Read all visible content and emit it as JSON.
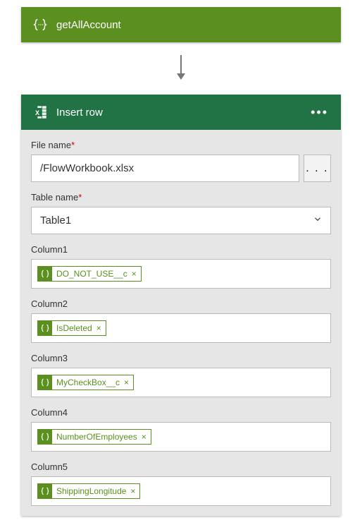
{
  "trigger": {
    "title": "getAllAccount"
  },
  "action": {
    "title": "Insert row",
    "fields": {
      "fileName": {
        "label": "File name",
        "value": "/FlowWorkbook.xlsx",
        "required": true
      },
      "tableName": {
        "label": "Table name",
        "value": "Table1",
        "required": true
      },
      "columns": [
        {
          "label": "Column1",
          "token": "DO_NOT_USE__c"
        },
        {
          "label": "Column2",
          "token": "IsDeleted"
        },
        {
          "label": "Column3",
          "token": "MyCheckBox__c"
        },
        {
          "label": "Column4",
          "token": "NumberOfEmployees"
        },
        {
          "label": "Column5",
          "token": "ShippingLongitude"
        }
      ]
    }
  }
}
